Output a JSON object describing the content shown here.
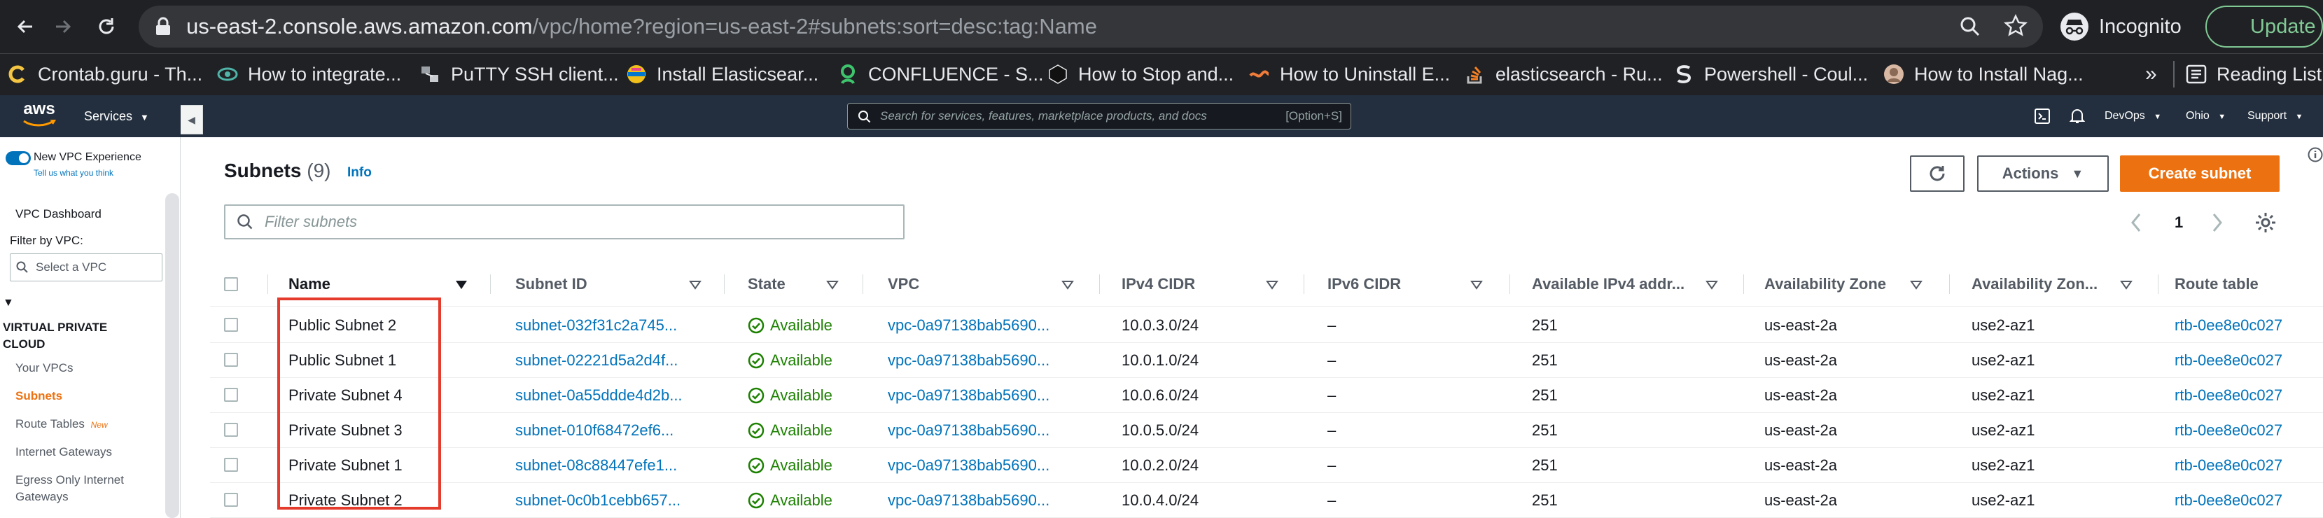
{
  "browser": {
    "url_host": "us-east-2.console.aws.amazon.com",
    "url_path": "/vpc/home?region=us-east-2#subnets:sort=desc:tag:Name",
    "incognito_label": "Incognito",
    "update_label": "Update",
    "bookmarks": [
      {
        "label": "Crontab.guru - Th...",
        "icon": "crontab-icon"
      },
      {
        "label": "How to integrate...",
        "icon": "eye-icon"
      },
      {
        "label": "PuTTY SSH client...",
        "icon": "putty-icon"
      },
      {
        "label": "Install Elasticsear...",
        "icon": "elastic-icon"
      },
      {
        "label": "CONFLUENCE - S...",
        "icon": "confluence-icon"
      },
      {
        "label": "How to Stop and...",
        "icon": "cube-icon"
      },
      {
        "label": "How to Uninstall E...",
        "icon": "wave-icon"
      },
      {
        "label": "elasticsearch - Ru...",
        "icon": "stackoverflow-icon"
      },
      {
        "label": "Powershell - Coul...",
        "icon": "s-logo-icon"
      },
      {
        "label": "How to Install Nag...",
        "icon": "avatar-icon"
      }
    ],
    "overflow_label": "»",
    "reading_list_label": "Reading List"
  },
  "aws_header": {
    "logo_text": "aws",
    "services_label": "Services",
    "search_placeholder": "Search for services, features, marketplace products, and docs",
    "search_shortcut": "[Option+S]",
    "account_label": "DevOps",
    "region_label": "Ohio",
    "support_label": "Support"
  },
  "leftnav": {
    "new_experience_label": "New VPC Experience",
    "feedback_link": "Tell us what you think",
    "dashboard_label": "VPC Dashboard",
    "filter_label": "Filter by VPC:",
    "filter_placeholder": "Select a VPC",
    "section_title_line1": "VIRTUAL PRIVATE",
    "section_title_line2": "CLOUD",
    "items": [
      {
        "label": "Your VPCs",
        "active": false
      },
      {
        "label": "Subnets",
        "active": true
      },
      {
        "label": "Route Tables",
        "active": false,
        "badge": "New"
      },
      {
        "label": "Internet Gateways",
        "active": false
      },
      {
        "label": "Egress Only Internet",
        "active": false
      },
      {
        "label": "Gateways",
        "active": false
      }
    ]
  },
  "panel": {
    "title": "Subnets",
    "count": "(9)",
    "info_label": "Info",
    "actions_label": "Actions",
    "create_label": "Create subnet",
    "filter_placeholder": "Filter subnets",
    "current_page": "1"
  },
  "table": {
    "columns": [
      "Name",
      "Subnet ID",
      "State",
      "VPC",
      "IPv4 CIDR",
      "IPv6 CIDR",
      "Available IPv4 addr...",
      "Availability Zone",
      "Availability Zon...",
      "Route table"
    ],
    "rows": [
      {
        "name": "Public Subnet 2",
        "subnet_id": "subnet-032f31c2a745...",
        "state": "Available",
        "vpc": "vpc-0a97138bab5690...",
        "ipv4": "10.0.3.0/24",
        "ipv6": "–",
        "avail": "251",
        "az": "us-east-2a",
        "az_id": "use2-az1",
        "route": "rtb-0ee8e0c027"
      },
      {
        "name": "Public Subnet 1",
        "subnet_id": "subnet-02221d5a2d4f...",
        "state": "Available",
        "vpc": "vpc-0a97138bab5690...",
        "ipv4": "10.0.1.0/24",
        "ipv6": "–",
        "avail": "251",
        "az": "us-east-2a",
        "az_id": "use2-az1",
        "route": "rtb-0ee8e0c027"
      },
      {
        "name": "Private Subnet 4",
        "subnet_id": "subnet-0a55ddde4d2b...",
        "state": "Available",
        "vpc": "vpc-0a97138bab5690...",
        "ipv4": "10.0.6.0/24",
        "ipv6": "–",
        "avail": "251",
        "az": "us-east-2a",
        "az_id": "use2-az1",
        "route": "rtb-0ee8e0c027"
      },
      {
        "name": "Private Subnet 3",
        "subnet_id": "subnet-010f68472ef6...",
        "state": "Available",
        "vpc": "vpc-0a97138bab5690...",
        "ipv4": "10.0.5.0/24",
        "ipv6": "–",
        "avail": "251",
        "az": "us-east-2a",
        "az_id": "use2-az1",
        "route": "rtb-0ee8e0c027"
      },
      {
        "name": "Private Subnet 1",
        "subnet_id": "subnet-08c88447efe1...",
        "state": "Available",
        "vpc": "vpc-0a97138bab5690...",
        "ipv4": "10.0.2.0/24",
        "ipv6": "–",
        "avail": "251",
        "az": "us-east-2a",
        "az_id": "use2-az1",
        "route": "rtb-0ee8e0c027"
      },
      {
        "name": "Private Subnet 2",
        "subnet_id": "subnet-0c0b1cebb657...",
        "state": "Available",
        "vpc": "vpc-0a97138bab5690...",
        "ipv4": "10.0.4.0/24",
        "ipv6": "–",
        "avail": "251",
        "az": "us-east-2a",
        "az_id": "use2-az1",
        "route": "rtb-0ee8e0c027"
      }
    ]
  },
  "colors": {
    "aws_orange": "#ec7211",
    "link_blue": "#0073bb",
    "available_green": "#1d8102",
    "annotation_red": "#e53b2c"
  }
}
